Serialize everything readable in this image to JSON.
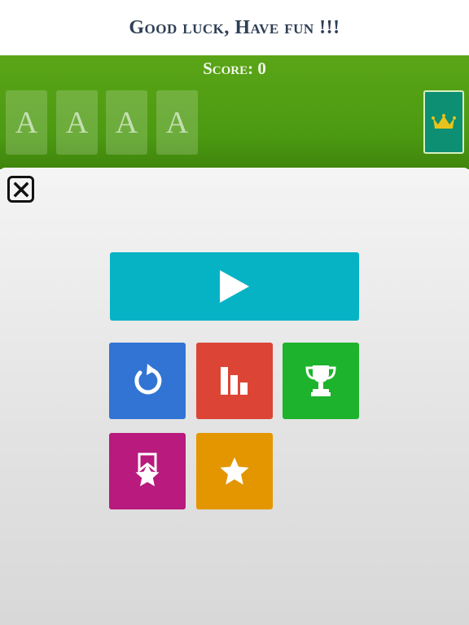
{
  "header": {
    "title": "Good luck, Have fun !!!"
  },
  "game_bar": {
    "score_label": "Score: 0",
    "foundations": [
      "A",
      "A",
      "A",
      "A"
    ]
  },
  "colors": {
    "green": "#4c9a12",
    "play": "#05b3c5",
    "undo": "#3174d4",
    "stats": "#dc4535",
    "trophy": "#1db32c",
    "achievements": "#b81a7d",
    "rate": "#e39600",
    "stock": "#0c8f72",
    "crown": "#e8c21c"
  },
  "menu": {
    "icons": {
      "close": "close-icon",
      "play": "play-icon",
      "undo": "undo-icon",
      "stats": "bar-chart-icon",
      "trophy": "trophy-icon",
      "achievements": "badge-star-icon",
      "rate": "star-icon",
      "stock": "crown-icon"
    }
  }
}
